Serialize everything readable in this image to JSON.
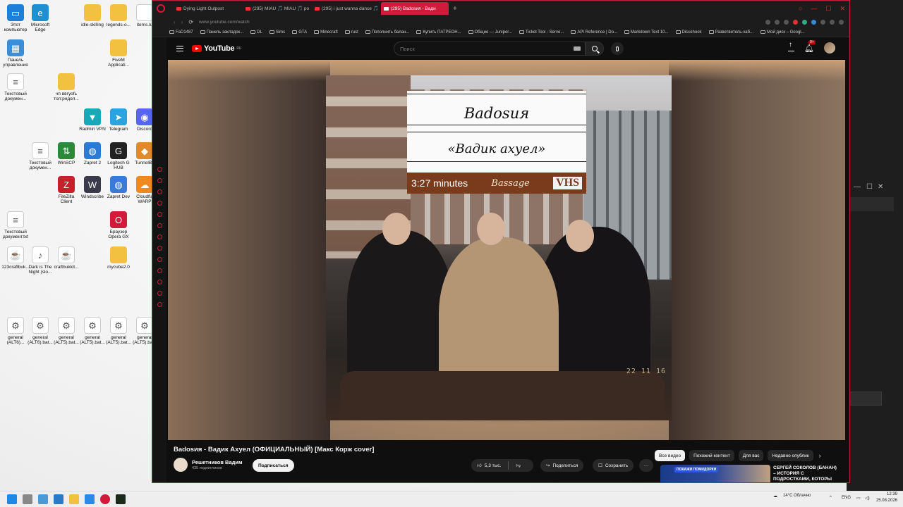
{
  "desktop": {
    "icons": [
      {
        "label": "Этот компьютер",
        "color": "#1e7fd8",
        "glyph": "▭"
      },
      {
        "label": "Microsoft Edge",
        "color": "#1e8fd0",
        "glyph": "e"
      },
      {
        "label": "idle-skilling",
        "color": "#f2c140",
        "glyph": ""
      },
      {
        "label": "legends-o...",
        "color": "#f2c140",
        "glyph": ""
      },
      {
        "label": "items.lu",
        "color": "#ffffff",
        "glyph": ""
      },
      {
        "label": "Панель управления",
        "color": "#3a8fd8",
        "glyph": "▦"
      },
      {
        "label": "FiveM Applicati...",
        "color": "#f2c140",
        "glyph": ""
      },
      {
        "label": "Текстовый докумен...",
        "color": "#ffffff",
        "glyph": "≡"
      },
      {
        "label": "чп ввгуоfь тол:рндол...",
        "color": "#f2c140",
        "glyph": ""
      },
      {
        "label": "Radmin VPN",
        "color": "#17a9b8",
        "glyph": "▼"
      },
      {
        "label": "Telegram",
        "color": "#2aa3de",
        "glyph": "➤"
      },
      {
        "label": "Discord",
        "color": "#5865f2",
        "glyph": "◉"
      },
      {
        "label": "Текстовый докумен...",
        "color": "#ffffff",
        "glyph": "≡"
      },
      {
        "label": "WinSCP",
        "color": "#2a8a3a",
        "glyph": "⇅"
      },
      {
        "label": "Zapret 2",
        "color": "#2a7ad8",
        "glyph": "◍"
      },
      {
        "label": "Logitech G HUB",
        "color": "#222222",
        "glyph": "G"
      },
      {
        "label": "TunnelBe",
        "color": "#e08a2a",
        "glyph": "◆"
      },
      {
        "label": "FileZilla Client",
        "color": "#c8202a",
        "glyph": "Z"
      },
      {
        "label": "Windscribe",
        "color": "#3a3a4a",
        "glyph": "W"
      },
      {
        "label": "Zapret Dev",
        "color": "#3a7ad8",
        "glyph": "◍"
      },
      {
        "label": "Cloudfla WARP",
        "color": "#f08a20",
        "glyph": "☁"
      },
      {
        "label": "Текстовый документ.txt",
        "color": "#ffffff",
        "glyph": "≡"
      },
      {
        "label": "Браузер Opera GX",
        "color": "#d21a3a",
        "glyph": "O"
      },
      {
        "label": "123craftbuk...",
        "color": "#ffffff",
        "glyph": "☕"
      },
      {
        "label": "Dark is The Night (slo...",
        "color": "#ffffff",
        "glyph": "♪"
      },
      {
        "label": "craftbukkit...",
        "color": "#ffffff",
        "glyph": "☕"
      },
      {
        "label": "mycube2.0",
        "color": "#f2c140",
        "glyph": ""
      },
      {
        "label": "general (ALT6)...",
        "color": "#ffffff",
        "glyph": "⚙"
      },
      {
        "label": "general (ALT6).bat...",
        "color": "#ffffff",
        "glyph": "⚙"
      },
      {
        "label": "general (ALT5).bat...",
        "color": "#ffffff",
        "glyph": "⚙"
      },
      {
        "label": "general (ALT5).bat...",
        "color": "#ffffff",
        "glyph": "⚙"
      },
      {
        "label": "general (ALT5).bat...",
        "color": "#ffffff",
        "glyph": "⚙"
      },
      {
        "label": "general (ALT5).ba...",
        "color": "#ffffff",
        "glyph": "⚙"
      }
    ]
  },
  "browser": {
    "tabs": [
      {
        "label": "Dying Light Outpost",
        "active": false
      },
      {
        "label": "(295) MIAU 🎵 MIAU 🎵 ро",
        "active": false
      },
      {
        "label": "(295) i just wanna dance 🎵",
        "active": false
      },
      {
        "label": "(295) Badosия - Вади",
        "active": true
      }
    ],
    "url": "www.youtube.com/watch",
    "bookmarks": [
      "FaD1487",
      "Панель закладок...",
      "DL",
      "Sims",
      "GTA",
      "Minecraft",
      "rust",
      "Пополнить балан...",
      "Купить ПАТРЕОН...",
      "Общие — Juniper...",
      "Ticket Tool - Serve...",
      "API Reference | Do...",
      "Markdown Text 10...",
      "Discohook",
      "Разветвитель-хаб...",
      "Мой диск – Googl..."
    ]
  },
  "youtube": {
    "logo": "YouTube",
    "region": "RU",
    "search_placeholder": "Поиск",
    "notif_count": "9+",
    "cover": {
      "artist": "Badosия",
      "song": "«Вадик ахуел»",
      "minutes": "3:27 minutes",
      "label": "Bassage",
      "vhs": "VHS",
      "stamp": "22 11 16"
    },
    "video_title": "Badosия - Вадик Ахуел (ОФИЦИАЛЬНЫЙ) [Макс Корж cover]",
    "channel": "Решетников Вадим",
    "subscribers": "435 подписчиков",
    "subscribe_label": "Подписаться",
    "likes": "5,3 тыс.",
    "share_label": "Поделиться",
    "save_label": "Сохранить",
    "chips": [
      "Все видео",
      "Похожий контент",
      "Для вас",
      "Недавно опублик"
    ],
    "rec_tag": "ПОКАЖИ ПОМИДОРКИ",
    "rec_title": "СЕРГЕЙ СОКОЛОВ (БАНАН) – ИСТОРИЯ С ПОДРОСТКАМИ, КОТОРЫ"
  },
  "taskbar": {
    "weather": "14°C Облачно",
    "lang": "ENG",
    "time": "12:39",
    "date": "25.08.2026"
  }
}
